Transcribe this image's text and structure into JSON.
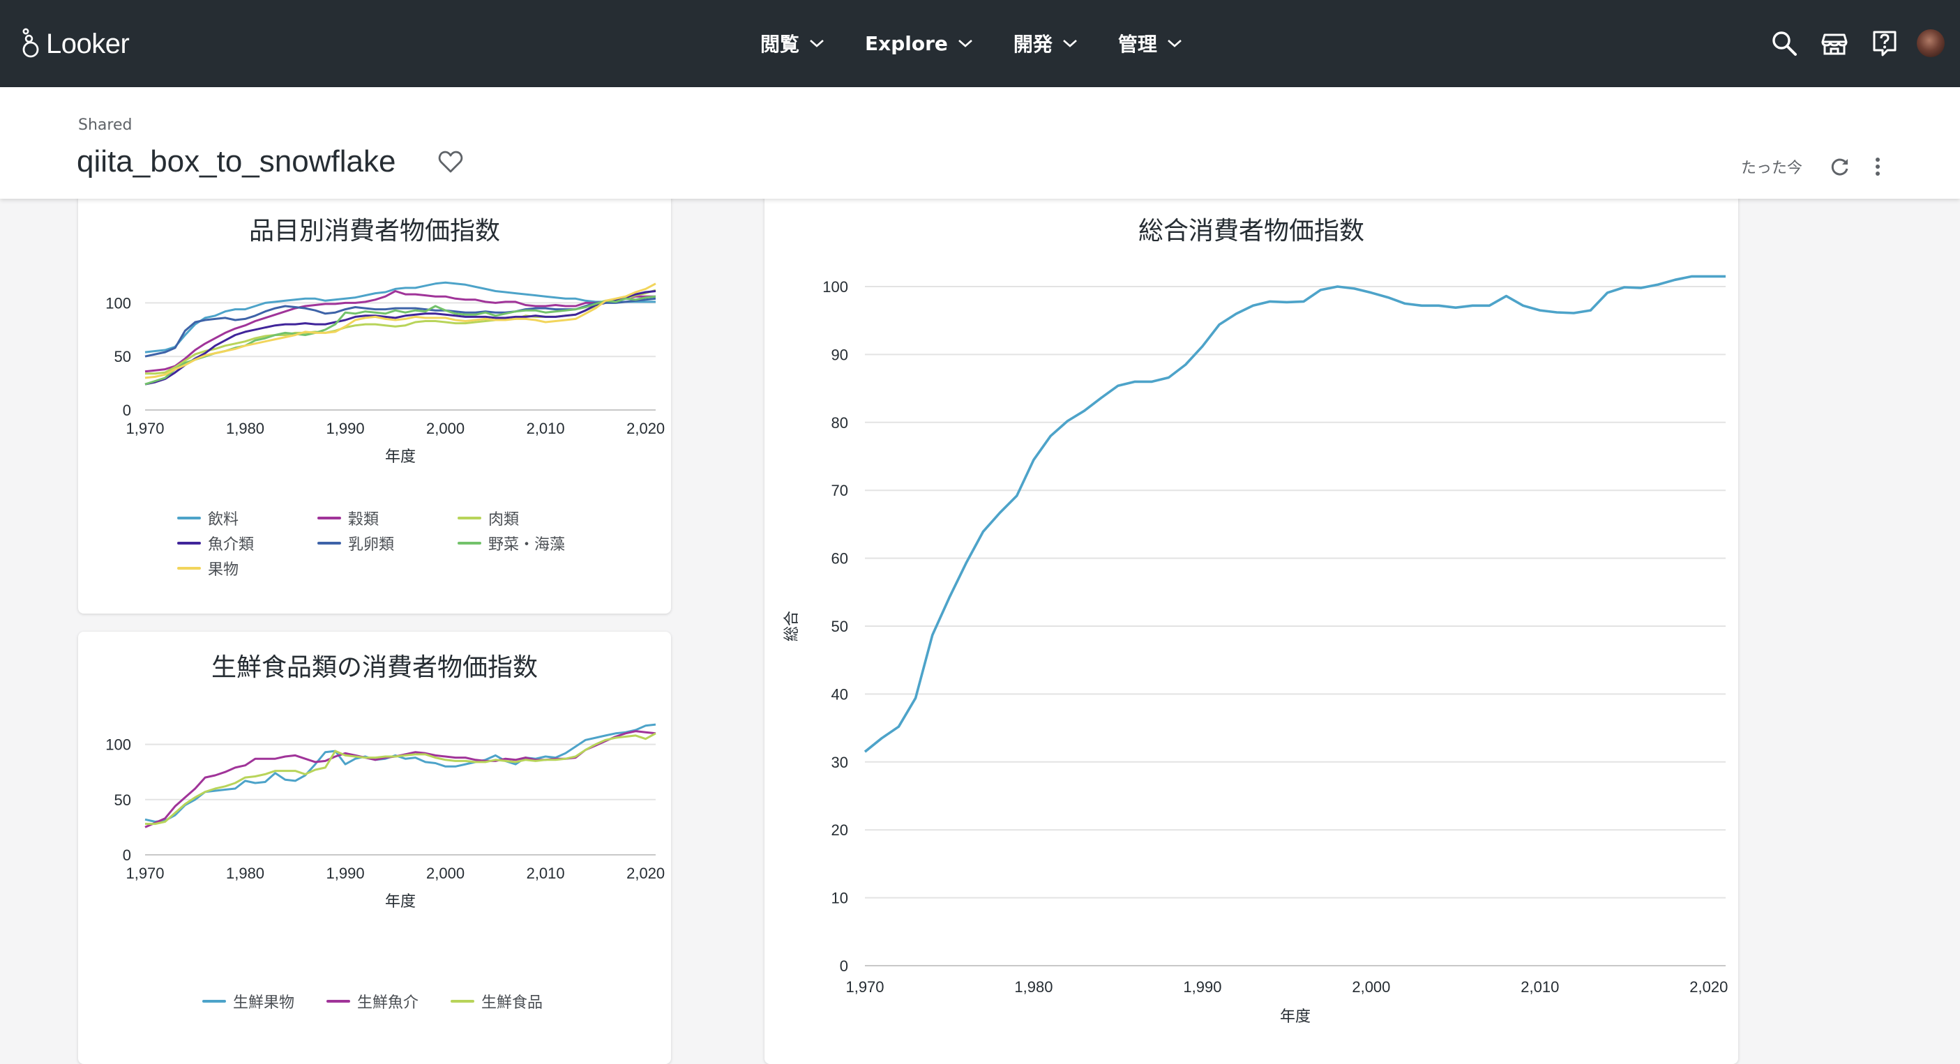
{
  "app": {
    "brand": "Looker",
    "nav": [
      {
        "label": "閲覧"
      },
      {
        "label": "Explore"
      },
      {
        "label": "開発"
      },
      {
        "label": "管理"
      }
    ]
  },
  "dashboard": {
    "breadcrumb": "Shared",
    "title": "qiita_box_to_snowflake",
    "last_updated": "たった今"
  },
  "chart_data": [
    {
      "type": "line",
      "title": "品目別消費者物価指数",
      "xlabel": "年度",
      "ylabel": "",
      "xlim": [
        1970,
        2021
      ],
      "ylim": [
        0,
        125
      ],
      "x_ticks": [
        "1,970",
        "1,980",
        "1,990",
        "2,000",
        "2,010",
        "2,020"
      ],
      "y_ticks": [
        "0",
        "50",
        "100"
      ],
      "legend_position": "bottom",
      "x": [
        1970,
        1971,
        1972,
        1973,
        1974,
        1975,
        1976,
        1977,
        1978,
        1979,
        1980,
        1981,
        1982,
        1983,
        1984,
        1985,
        1986,
        1987,
        1988,
        1989,
        1990,
        1991,
        1992,
        1993,
        1994,
        1995,
        1996,
        1997,
        1998,
        1999,
        2000,
        2001,
        2002,
        2003,
        2004,
        2005,
        2006,
        2007,
        2008,
        2009,
        2010,
        2011,
        2012,
        2013,
        2014,
        2015,
        2016,
        2017,
        2018,
        2019,
        2020,
        2021
      ],
      "series": [
        {
          "name": "飲料",
          "color": "#4da3c9",
          "values": [
            54,
            55,
            56,
            59,
            70,
            80,
            86,
            88,
            92,
            94,
            94,
            97,
            100,
            101,
            102,
            103,
            104,
            104,
            102,
            103,
            104,
            105,
            107,
            109,
            110,
            113,
            114,
            114,
            116,
            118,
            119,
            118,
            117,
            115,
            113,
            111,
            110,
            109,
            108,
            107,
            106,
            105,
            104,
            104,
            102,
            101,
            101,
            101,
            101,
            101,
            101,
            101
          ]
        },
        {
          "name": "穀類",
          "color": "#a03499",
          "values": [
            36,
            37,
            38,
            41,
            48,
            56,
            62,
            67,
            72,
            76,
            79,
            83,
            86,
            89,
            92,
            95,
            97,
            98,
            99,
            99,
            100,
            100,
            101,
            103,
            106,
            111,
            108,
            108,
            107,
            106,
            106,
            104,
            103,
            103,
            101,
            100,
            101,
            101,
            98,
            97,
            97,
            98,
            97,
            97,
            100,
            100,
            101,
            102,
            104,
            106,
            106,
            106
          ]
        },
        {
          "name": "肉類",
          "color": "#b8d45a",
          "values": [
            34,
            34,
            35,
            40,
            46,
            52,
            55,
            57,
            60,
            62,
            64,
            67,
            69,
            70,
            70,
            72,
            72,
            73,
            72,
            74,
            77,
            79,
            80,
            80,
            79,
            78,
            79,
            82,
            83,
            83,
            82,
            81,
            81,
            82,
            83,
            84,
            85,
            85,
            88,
            87,
            87,
            87,
            88,
            89,
            93,
            97,
            101,
            103,
            104,
            107,
            109,
            112
          ]
        },
        {
          "name": "魚介類",
          "color": "#40259a",
          "values": [
            24,
            26,
            29,
            35,
            42,
            48,
            53,
            60,
            65,
            70,
            73,
            75,
            77,
            79,
            80,
            80,
            81,
            80,
            80,
            82,
            84,
            87,
            88,
            88,
            87,
            86,
            88,
            89,
            90,
            90,
            89,
            88,
            87,
            87,
            87,
            86,
            86,
            87,
            87,
            88,
            87,
            87,
            88,
            89,
            93,
            98,
            100,
            102,
            105,
            108,
            110,
            111
          ]
        },
        {
          "name": "乳卵類",
          "color": "#3e63a8",
          "values": [
            50,
            52,
            54,
            58,
            74,
            82,
            84,
            85,
            86,
            84,
            85,
            88,
            92,
            95,
            97,
            96,
            95,
            93,
            90,
            91,
            94,
            96,
            95,
            94,
            94,
            95,
            95,
            95,
            94,
            93,
            93,
            92,
            91,
            91,
            92,
            91,
            91,
            92,
            94,
            95,
            95,
            94,
            94,
            94,
            97,
            100,
            100,
            100,
            101,
            102,
            103,
            104
          ]
        },
        {
          "name": "野菜・海藻",
          "color": "#73c26b",
          "values": [
            24,
            27,
            30,
            38,
            44,
            47,
            50,
            53,
            55,
            58,
            60,
            65,
            67,
            70,
            72,
            71,
            70,
            72,
            75,
            80,
            91,
            90,
            92,
            91,
            90,
            93,
            91,
            93,
            92,
            97,
            93,
            90,
            89,
            89,
            91,
            88,
            90,
            92,
            93,
            93,
            91,
            92,
            93,
            94,
            96,
            99,
            102,
            101,
            104,
            103,
            105,
            106
          ]
        },
        {
          "name": "果物",
          "color": "#f2d55c",
          "values": [
            30,
            31,
            33,
            38,
            42,
            47,
            51,
            53,
            55,
            57,
            60,
            62,
            64,
            66,
            68,
            70,
            73,
            72,
            72,
            73,
            78,
            84,
            86,
            87,
            85,
            84,
            85,
            87,
            86,
            86,
            86,
            84,
            83,
            84,
            85,
            84,
            84,
            85,
            85,
            84,
            82,
            83,
            84,
            85,
            90,
            95,
            102,
            104,
            106,
            110,
            113,
            118
          ]
        }
      ]
    },
    {
      "type": "line",
      "title": "生鮮食品類の消費者物価指数",
      "xlabel": "年度",
      "ylabel": "",
      "xlim": [
        1970,
        2021
      ],
      "ylim": [
        0,
        125
      ],
      "x_ticks": [
        "1,970",
        "1,980",
        "1,990",
        "2,000",
        "2,010",
        "2,020"
      ],
      "y_ticks": [
        "0",
        "50",
        "100"
      ],
      "legend_position": "bottom",
      "x": [
        1970,
        1971,
        1972,
        1973,
        1974,
        1975,
        1976,
        1977,
        1978,
        1979,
        1980,
        1981,
        1982,
        1983,
        1984,
        1985,
        1986,
        1987,
        1988,
        1989,
        1990,
        1991,
        1992,
        1993,
        1994,
        1995,
        1996,
        1997,
        1998,
        1999,
        2000,
        2001,
        2002,
        2003,
        2004,
        2005,
        2006,
        2007,
        2008,
        2009,
        2010,
        2011,
        2012,
        2013,
        2014,
        2015,
        2016,
        2017,
        2018,
        2019,
        2020,
        2021
      ],
      "series": [
        {
          "name": "生鮮果物",
          "color": "#4da3c9",
          "values": [
            32,
            30,
            31,
            36,
            45,
            50,
            57,
            58,
            59,
            60,
            67,
            65,
            66,
            74,
            68,
            67,
            72,
            82,
            93,
            94,
            82,
            87,
            89,
            86,
            87,
            90,
            87,
            88,
            84,
            83,
            80,
            80,
            82,
            84,
            86,
            90,
            85,
            82,
            88,
            87,
            89,
            88,
            92,
            98,
            104,
            106,
            108,
            110,
            111,
            113,
            117,
            118
          ]
        },
        {
          "name": "生鮮魚介",
          "color": "#a03499",
          "values": [
            25,
            29,
            33,
            44,
            52,
            60,
            70,
            72,
            75,
            79,
            81,
            87,
            87,
            87,
            89,
            90,
            87,
            84,
            85,
            89,
            92,
            90,
            88,
            86,
            88,
            89,
            91,
            93,
            92,
            90,
            89,
            88,
            88,
            86,
            85,
            85,
            87,
            86,
            88,
            86,
            86,
            87,
            87,
            88,
            95,
            99,
            103,
            107,
            110,
            112,
            111,
            110
          ]
        },
        {
          "name": "生鮮食品",
          "color": "#b8d45a",
          "values": [
            28,
            28,
            30,
            38,
            46,
            52,
            57,
            60,
            62,
            65,
            70,
            71,
            73,
            76,
            76,
            76,
            73,
            77,
            79,
            94,
            90,
            89,
            88,
            88,
            89,
            89,
            90,
            91,
            91,
            88,
            86,
            85,
            85,
            84,
            84,
            86,
            85,
            84,
            86,
            85,
            86,
            86,
            87,
            89,
            95,
            100,
            104,
            106,
            107,
            108,
            105,
            110
          ]
        }
      ]
    },
    {
      "type": "line",
      "title": "総合消費者物価指数",
      "xlabel": "年度",
      "ylabel": "総合",
      "xlim": [
        1970,
        2021
      ],
      "ylim": [
        0,
        100
      ],
      "x_ticks": [
        "1,970",
        "1,980",
        "1,990",
        "2,000",
        "2,010",
        "2,020"
      ],
      "y_ticks": [
        "0",
        "10",
        "20",
        "30",
        "40",
        "50",
        "60",
        "70",
        "80",
        "90",
        "100"
      ],
      "legend_position": "none",
      "x": [
        1970,
        1971,
        1972,
        1973,
        1974,
        1975,
        1976,
        1977,
        1978,
        1979,
        1980,
        1981,
        1982,
        1983,
        1984,
        1985,
        1986,
        1987,
        1988,
        1989,
        1990,
        1991,
        1992,
        1993,
        1994,
        1995,
        1996,
        1997,
        1998,
        1999,
        2000,
        2001,
        2002,
        2003,
        2004,
        2005,
        2006,
        2007,
        2008,
        2009,
        2010,
        2011,
        2012,
        2013,
        2014,
        2015,
        2016,
        2017,
        2018,
        2019,
        2020,
        2021
      ],
      "series": [
        {
          "name": "総合",
          "color": "#4da3c9",
          "values": [
            31.5,
            33.5,
            35.2,
            39.4,
            48.7,
            54.2,
            59.3,
            63.9,
            66.7,
            69.2,
            74.5,
            78.0,
            80.2,
            81.7,
            83.6,
            85.4,
            86.0,
            86.0,
            86.6,
            88.5,
            91.2,
            94.4,
            96.0,
            97.2,
            97.8,
            97.7,
            97.8,
            99.5,
            100.0,
            99.7,
            99.1,
            98.4,
            97.5,
            97.2,
            97.2,
            96.9,
            97.2,
            97.2,
            98.6,
            97.2,
            96.5,
            96.2,
            96.1,
            96.5,
            99.1,
            99.9,
            99.8,
            100.3,
            101.0,
            101.5,
            101.5,
            101.5
          ]
        }
      ]
    }
  ]
}
